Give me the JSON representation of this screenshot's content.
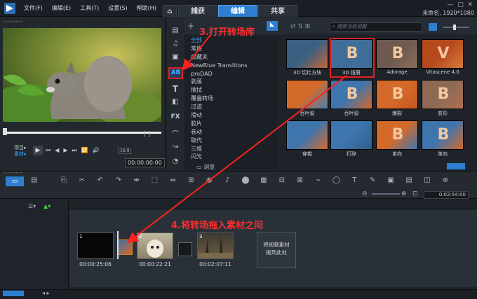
{
  "menu": [
    "文件(F)",
    "编辑(E)",
    "工具(T)",
    "设置(S)",
    "帮助(H)"
  ],
  "tabs": {
    "home": "⌂",
    "capture": "捕获",
    "edit": "编辑",
    "share": "共享"
  },
  "project_info": "未命名, 1920*1080",
  "window_controls": [
    "—",
    "□",
    "✕"
  ],
  "preview": {
    "mode_project": "项目▸",
    "mode_clip": "素材▸",
    "timecode": "00:00:00:00",
    "ratio": "16:9"
  },
  "library": {
    "search_placeholder": "搜索当前视图",
    "categories": [
      "全部",
      "常用",
      "收藏夹",
      "NewBlue Transitions",
      "proDAD",
      "剥落",
      "擦拭",
      "覆叠转场",
      "过滤",
      "滑动",
      "胶片",
      "卷动",
      "取代",
      "三维",
      "闪光"
    ],
    "browse": "浏览",
    "transitions": [
      {
        "label": "3D 切片方块",
        "letter": "",
        "bg1": "#3a5f80",
        "bg2": "#c2663a"
      },
      {
        "label": "3D 纸屑",
        "letter": "B",
        "bg1": "#3f6e98",
        "bg2": "#3f6e98"
      },
      {
        "label": "Adorage",
        "letter": "B",
        "bg1": "#6e5a4f",
        "bg2": "#8a6c5a"
      },
      {
        "label": "Vitascene 4.0",
        "letter": "V",
        "bg1": "#b64a1d",
        "bg2": "#d87a3a"
      },
      {
        "label": "百叶窗",
        "letter": "",
        "bg1": "#d46a2a",
        "bg2": "#4a7fb3"
      },
      {
        "label": "百叶窗",
        "letter": "B",
        "bg1": "#3f75ad",
        "bg2": "#d46a2a"
      },
      {
        "label": "爆裂",
        "letter": "B",
        "bg1": "#d46a2a",
        "bg2": "#c55a20"
      },
      {
        "label": "变形",
        "letter": "B",
        "bg1": "#8e6a55",
        "bg2": "#b07050"
      },
      {
        "label": "穿梭",
        "letter": "",
        "bg1": "#3f75ad",
        "bg2": "#d46a2a"
      },
      {
        "label": "打碎",
        "letter": "",
        "bg1": "#3f75ad",
        "bg2": "#2f5d8a"
      },
      {
        "label": "单向",
        "letter": "B",
        "bg1": "#d46a2a",
        "bg2": "#3f75ad"
      },
      {
        "label": "单向",
        "letter": "B",
        "bg1": "#3f75ad",
        "bg2": "#d46a2a"
      }
    ]
  },
  "annotations": {
    "step3": "3.打开转场库",
    "step4": "4.将转场拖入素材之间"
  },
  "timeline": {
    "timecode": "0:02:54:00",
    "clips": [
      {
        "index": "1",
        "timecode": "00:00:25:06"
      },
      {
        "index": "2",
        "timecode": "00:00:22:21"
      },
      {
        "index": "3",
        "timecode": "00:02:07:11"
      }
    ],
    "drop_text": "将视频素材拖到此处"
  },
  "side_tools": [
    "▶▶",
    "🎵",
    "📷",
    "AB",
    "T",
    "◐",
    "FX",
    "~",
    "↗",
    "◔"
  ],
  "side_labels": {
    "media": "媒体",
    "transition": "转场",
    "title": "T",
    "fx": "FX"
  }
}
